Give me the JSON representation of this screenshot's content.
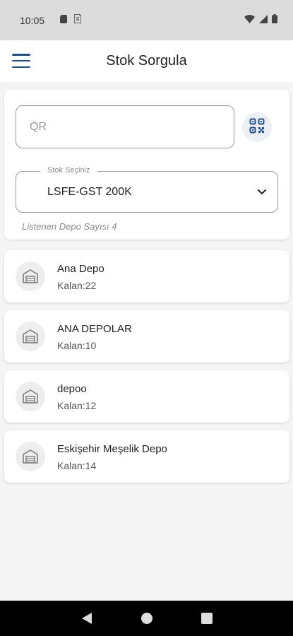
{
  "status_bar": {
    "time": "10:05",
    "icons": [
      "sd-card-icon",
      "sim-icon",
      "wifi-icon",
      "signal-icon",
      "battery-icon"
    ]
  },
  "app_bar": {
    "title": "Stok Sorgula",
    "menu_icon": "hamburger-menu-icon"
  },
  "search": {
    "qr_placeholder": "QR",
    "qr_scan_icon": "qr-code-scan-icon",
    "stock_select_label": "Stok Seçiniz",
    "stock_select_value": "LSFE-GST 200K",
    "depot_count_text": "Listenen Depo Sayısı 4"
  },
  "depots": [
    {
      "name": "Ana Depo",
      "remaining": "Kalan:22",
      "icon": "warehouse-icon"
    },
    {
      "name": "ANA DEPOLAR",
      "remaining": "Kalan:10",
      "icon": "warehouse-icon"
    },
    {
      "name": "depoo",
      "remaining": "Kalan:12",
      "icon": "warehouse-icon"
    },
    {
      "name": "Eskişehir Meşelik Depo",
      "remaining": "Kalan:14",
      "icon": "warehouse-icon"
    }
  ],
  "colors": {
    "accent": "#1f4f8f",
    "background": "#f4f4f4",
    "status_bar": "#dcdcdc",
    "nav_bar": "#000000"
  },
  "nav_bar": {
    "icons": [
      "back-icon",
      "home-icon",
      "recents-icon"
    ]
  }
}
